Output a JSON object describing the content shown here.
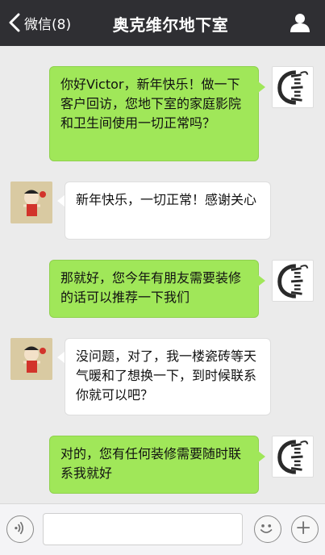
{
  "header": {
    "back_label": "微信(8)",
    "title": "奥克维尔地下室"
  },
  "messages": [
    {
      "sender": "me",
      "text": "你好Victor，新年快乐！做一下客户回访，您地下室的家庭影院和卫生间使用一切正常吗？"
    },
    {
      "sender": "them",
      "text": "新年快乐，一切正常！感谢关心"
    },
    {
      "sender": "me",
      "text": "那就好，您今年有朋友需要装修的话可以推荐一下我们"
    },
    {
      "sender": "them",
      "text": "没问题，对了，我一楼瓷砖等天气暖和了想换一下，到时候联系你就可以吧？"
    },
    {
      "sender": "me",
      "text": "对的，您有任何装修需要随时联系我就好"
    }
  ],
  "input_bar": {
    "message_value": ""
  },
  "colors": {
    "topbar": "#2f2f33",
    "bubble_me": "#a0e759",
    "bubble_them": "#ffffff",
    "chat_bg": "#ebebeb"
  },
  "icons": [
    "chevron-left-icon",
    "profile-icon",
    "voice-icon",
    "emoji-icon",
    "plus-icon",
    "company-logo",
    "user-avatar"
  ]
}
